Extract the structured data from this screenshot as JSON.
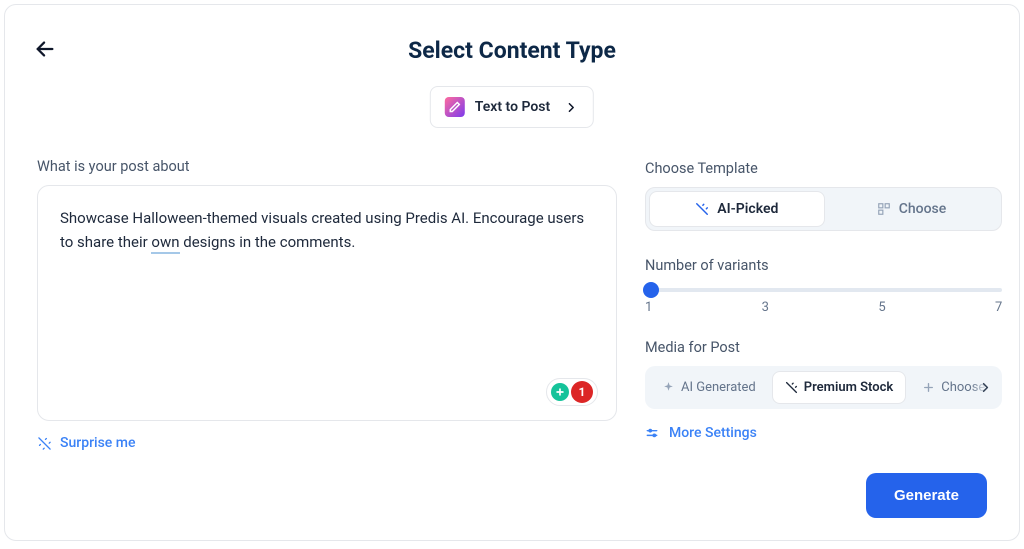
{
  "header": {
    "title": "Select Content Type",
    "contentType": "Text to Post"
  },
  "post": {
    "label": "What is your post about",
    "text_before": "Showcase Halloween-themed visuals created using Predis AI. Encourage users to share their ",
    "underlined_word": "own",
    "text_after": " designs in the comments.",
    "grammarly_count": "1",
    "surprise_me": "Surprise me"
  },
  "template": {
    "label": "Choose Template",
    "ai_picked": "AI-Picked",
    "choose": "Choose"
  },
  "variants": {
    "label": "Number of variants",
    "ticks": [
      "1",
      "3",
      "5",
      "7"
    ]
  },
  "media": {
    "label": "Media for Post",
    "ai_generated": "AI Generated",
    "premium_stock": "Premium Stock",
    "choose_own": "Choose"
  },
  "more_settings": "More Settings",
  "generate": "Generate"
}
